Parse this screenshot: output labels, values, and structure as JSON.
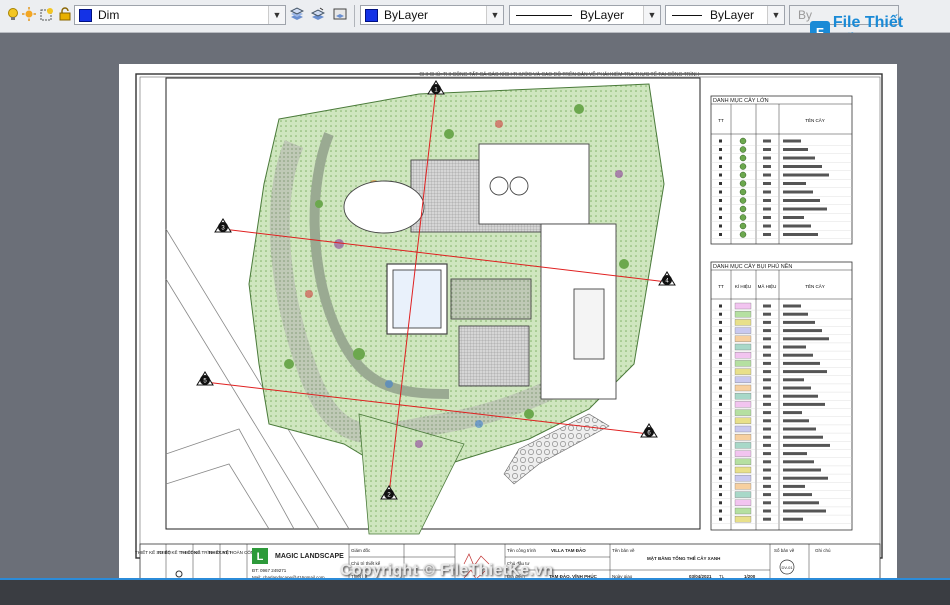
{
  "toolbar": {
    "layer_name": "Dim",
    "color_value": "ByLayer",
    "linetype_value": "ByLayer",
    "lineweight_value": "ByLayer",
    "plotstyle_value": "By"
  },
  "logo": {
    "text": "File Thiết Kế.vn"
  },
  "watermark": "Copyright © FileThietKe.vn",
  "drawing": {
    "top_note": "GHI CHÚ: THI CÔNG TẤT CẢ CÁC KÍCH THƯỚC VÀ CAO ĐỘ TRÊN BẢN VẼ PHẢI KIỂM TRA THỰC TẾ TẠI CÔNG TRÌNH",
    "section_markers": [
      "1",
      "2",
      "3",
      "4",
      "5",
      "6"
    ],
    "table1": {
      "title": "DANH MỤC CÂY LỚN",
      "headers": [
        "TT",
        "",
        "",
        "TÊN CÂY"
      ]
    },
    "table2": {
      "title": "DANH MỤC CÂY BỤI PHỦ NỀN",
      "headers": [
        "TT",
        "KÍ HIỆU",
        "MÃ HIỆU",
        "TÊN CÂY"
      ]
    },
    "title_block": {
      "stage1": "THIẾT KẾ SƠ BỘ",
      "stage2": "THIẾT KẾ THI CÔNG",
      "stage3": "THIẾT KẾ TRÌNH DUYỆT",
      "stage4": "THIẾT KẾ HOÀN CÔNG",
      "company": "MAGIC LANDSCAPE",
      "phone": "ĐT: 0967 249271",
      "email": "Mail: charlandscape@416gmail.com",
      "director_label": "Giám đốc",
      "chief_label": "Chủ trì thiết kế",
      "designer_label": "Thiết kế",
      "project_label": "Tên công trình",
      "project_value": "VILLA TAM ĐẢO",
      "investor_label": "Chủ đầu tư",
      "location_label": "Địa điểm",
      "location_value": "TAM ĐẢO, VĨNH PHÚC",
      "drawing_label": "Tên bản vẽ",
      "drawing_value": "MẶT BẰNG TỔNG THỂ CÂY XANH",
      "date_label": "Ngày giao",
      "date_value": "03/04/2021",
      "scale_label": "TL",
      "scale_value": "1/200",
      "sheet_label": "Số bản vẽ",
      "sheet_value": "DV-01",
      "note_label": "Ghi chú"
    }
  },
  "colors": {
    "canvas_bg": "#6b6f78",
    "paper": "#ffffff",
    "section_line": "#e02020",
    "plant_green": "#8fc27a",
    "path_gray": "#b9b9b9"
  }
}
